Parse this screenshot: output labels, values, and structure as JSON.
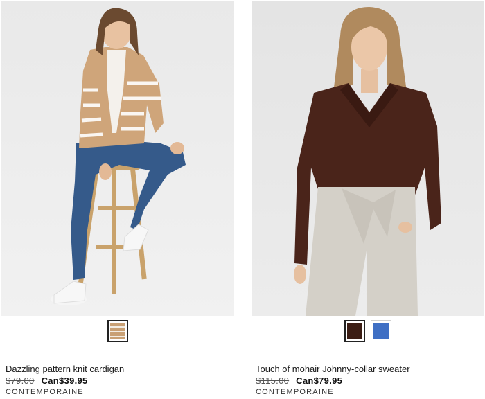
{
  "products": [
    {
      "name": "Dazzling pattern knit cardigan",
      "old_price": "$79.00",
      "new_price": "Can$39.95",
      "brand": "CONTEMPORAINE",
      "swatches": [
        {
          "color": "#c9a074",
          "selected": true,
          "label": "camel stripe"
        }
      ]
    },
    {
      "name": "Touch of mohair Johnny-collar sweater",
      "old_price": "$115.00",
      "new_price": "Can$79.95",
      "brand": "CONTEMPORAINE",
      "swatches": [
        {
          "color": "#3b1d14",
          "selected": true,
          "label": "brown"
        },
        {
          "color": "#3f6fc4",
          "selected": false,
          "label": "blue"
        }
      ]
    }
  ]
}
